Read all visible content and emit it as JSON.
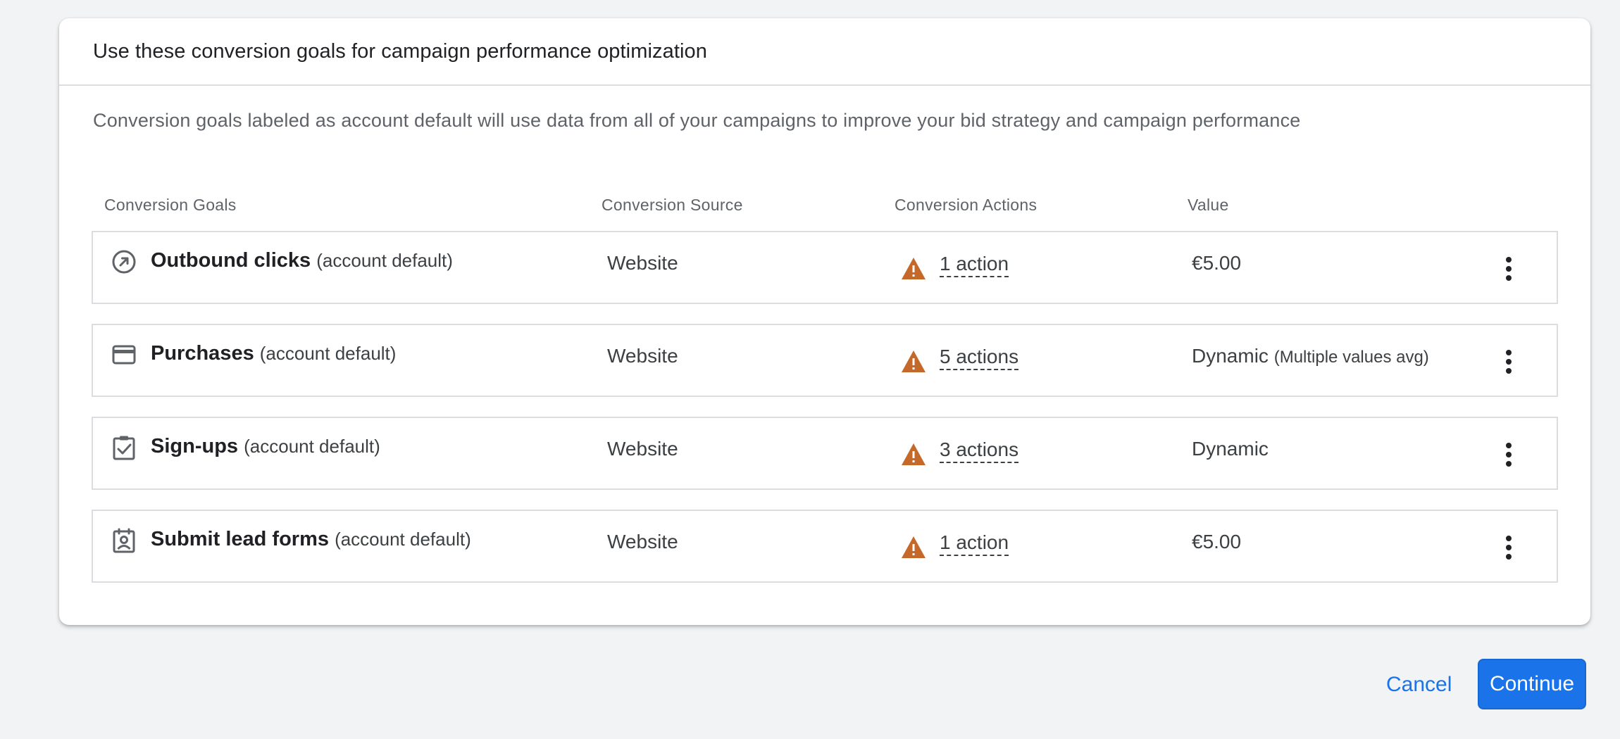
{
  "dialog": {
    "title": "Use these conversion goals for campaign performance optimization",
    "description": "Conversion goals labeled as account default will use data from all of your campaigns to improve your bid strategy and campaign performance"
  },
  "columns": {
    "goals": "Conversion Goals",
    "source": "Conversion Source",
    "actions": "Conversion Actions",
    "value": "Value"
  },
  "rows": [
    {
      "icon": "outbound-arrow-icon",
      "name": "Outbound clicks",
      "suffix": "(account default)",
      "source": "Website",
      "actions": "1 action",
      "value": "€5.00",
      "value_note": ""
    },
    {
      "icon": "credit-card-icon",
      "name": "Purchases",
      "suffix": "(account default)",
      "source": "Website",
      "actions": "5 actions",
      "value": "Dynamic",
      "value_note": "(Multiple values avg)"
    },
    {
      "icon": "clipboard-check-icon",
      "name": "Sign-ups",
      "suffix": "(account default)",
      "source": "Website",
      "actions": "3 actions",
      "value": "Dynamic",
      "value_note": ""
    },
    {
      "icon": "contact-form-icon",
      "name": "Submit lead forms",
      "suffix": "(account default)",
      "source": "Website",
      "actions": "1 action",
      "value": "€5.00",
      "value_note": ""
    }
  ],
  "footer": {
    "cancel_label": "Cancel",
    "continue_label": "Continue"
  },
  "colors": {
    "accent": "#1a73e8",
    "warning": "#c5692b",
    "border": "#dadce0",
    "background": "#f1f3f4"
  }
}
